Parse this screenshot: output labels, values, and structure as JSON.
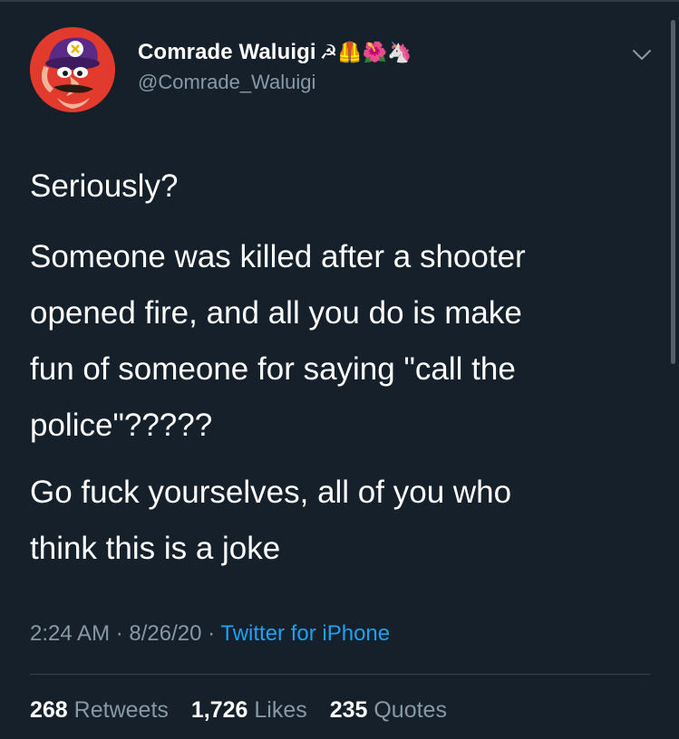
{
  "user": {
    "display_name": "Comrade Waluigi",
    "name_emojis": "☭🦺🌺🦄",
    "handle": "@Comrade_Waluigi"
  },
  "tweet": {
    "paragraphs": [
      [
        "Seriously?"
      ],
      [
        "Someone was killed after a shooter",
        "opened fire, and all you do is make",
        "fun of someone for saying \"call the",
        "police\"?????"
      ],
      [
        "Go fuck yourselves, all of you who",
        "think this is a joke"
      ]
    ]
  },
  "meta": {
    "time": "2:24 AM",
    "sep1": " · ",
    "date": "8/26/20",
    "sep2": " · ",
    "source": "Twitter for iPhone"
  },
  "stats": {
    "retweets_count": "268",
    "retweets_label": "Retweets",
    "likes_count": "1,726",
    "likes_label": "Likes",
    "quotes_count": "235",
    "quotes_label": "Quotes"
  },
  "colors": {
    "background": "#15202b",
    "secondary_text": "#8899a6",
    "link": "#1da1f2"
  }
}
